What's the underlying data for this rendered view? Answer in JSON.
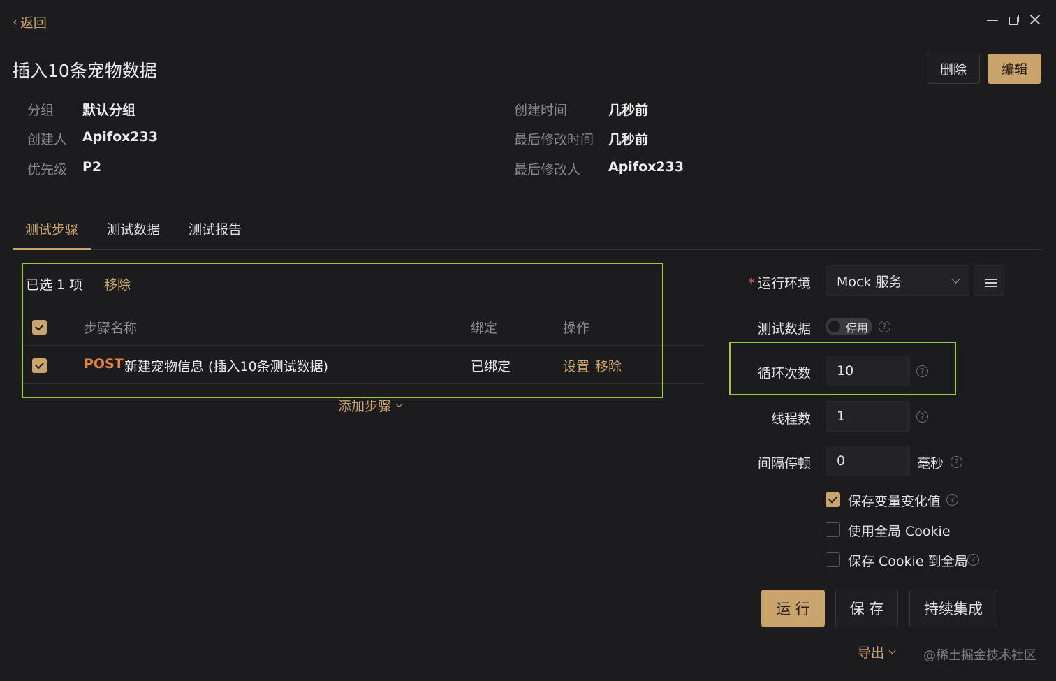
{
  "nav": {
    "back_chevron": "‹",
    "back_label": "返回"
  },
  "header": {
    "title": "插入10条宠物数据",
    "delete_label": "删除",
    "edit_label": "编辑"
  },
  "meta": {
    "group_label": "分组",
    "group_value": "默认分组",
    "creator_label": "创建人",
    "creator_value": "Apifox233",
    "priority_label": "优先级",
    "priority_value": "P2",
    "created_label": "创建时间",
    "created_value": "几秒前",
    "modified_label": "最后修改时间",
    "modified_value": "几秒前",
    "modifier_label": "最后修改人",
    "modifier_value": "Apifox233"
  },
  "tabs": [
    {
      "label": "测试步骤",
      "active": true
    },
    {
      "label": "测试数据",
      "active": false
    },
    {
      "label": "测试报告",
      "active": false
    }
  ],
  "steps": {
    "selected_text": "已选 1 项",
    "remove_label": "移除",
    "columns": {
      "name": "步骤名称",
      "binding": "绑定",
      "actions": "操作"
    },
    "rows": [
      {
        "checked": true,
        "method": "POST",
        "name": "新建宠物信息 (插入10条测试数据)",
        "binding": "已绑定",
        "action_settings": "设置",
        "action_remove": "移除"
      }
    ],
    "add_step_label": "添加步骤"
  },
  "run_config": {
    "env_label": "运行环境",
    "env_required_mark": "*",
    "env_value": "Mock 服务",
    "test_data_label": "测试数据",
    "test_data_toggle": "停用",
    "loop_label": "循环次数",
    "loop_value": "10",
    "threads_label": "线程数",
    "threads_value": "1",
    "interval_label": "间隔停顿",
    "interval_value": "0",
    "interval_unit": "毫秒",
    "help_glyph": "?",
    "options": [
      {
        "label": "保存变量变化值",
        "checked": true
      },
      {
        "label": "使用全局 Cookie",
        "checked": false
      },
      {
        "label": "保存 Cookie 到全局",
        "checked": false
      }
    ],
    "run_label": "运 行",
    "save_label": "保 存",
    "ci_label": "持续集成",
    "export_label": "导出"
  },
  "watermark": "@稀土掘金技术社区",
  "colors": {
    "accent": "#c9a46c",
    "highlight": "#9cc93a",
    "post": "#e8823c",
    "bg": "#1c1c1e"
  }
}
